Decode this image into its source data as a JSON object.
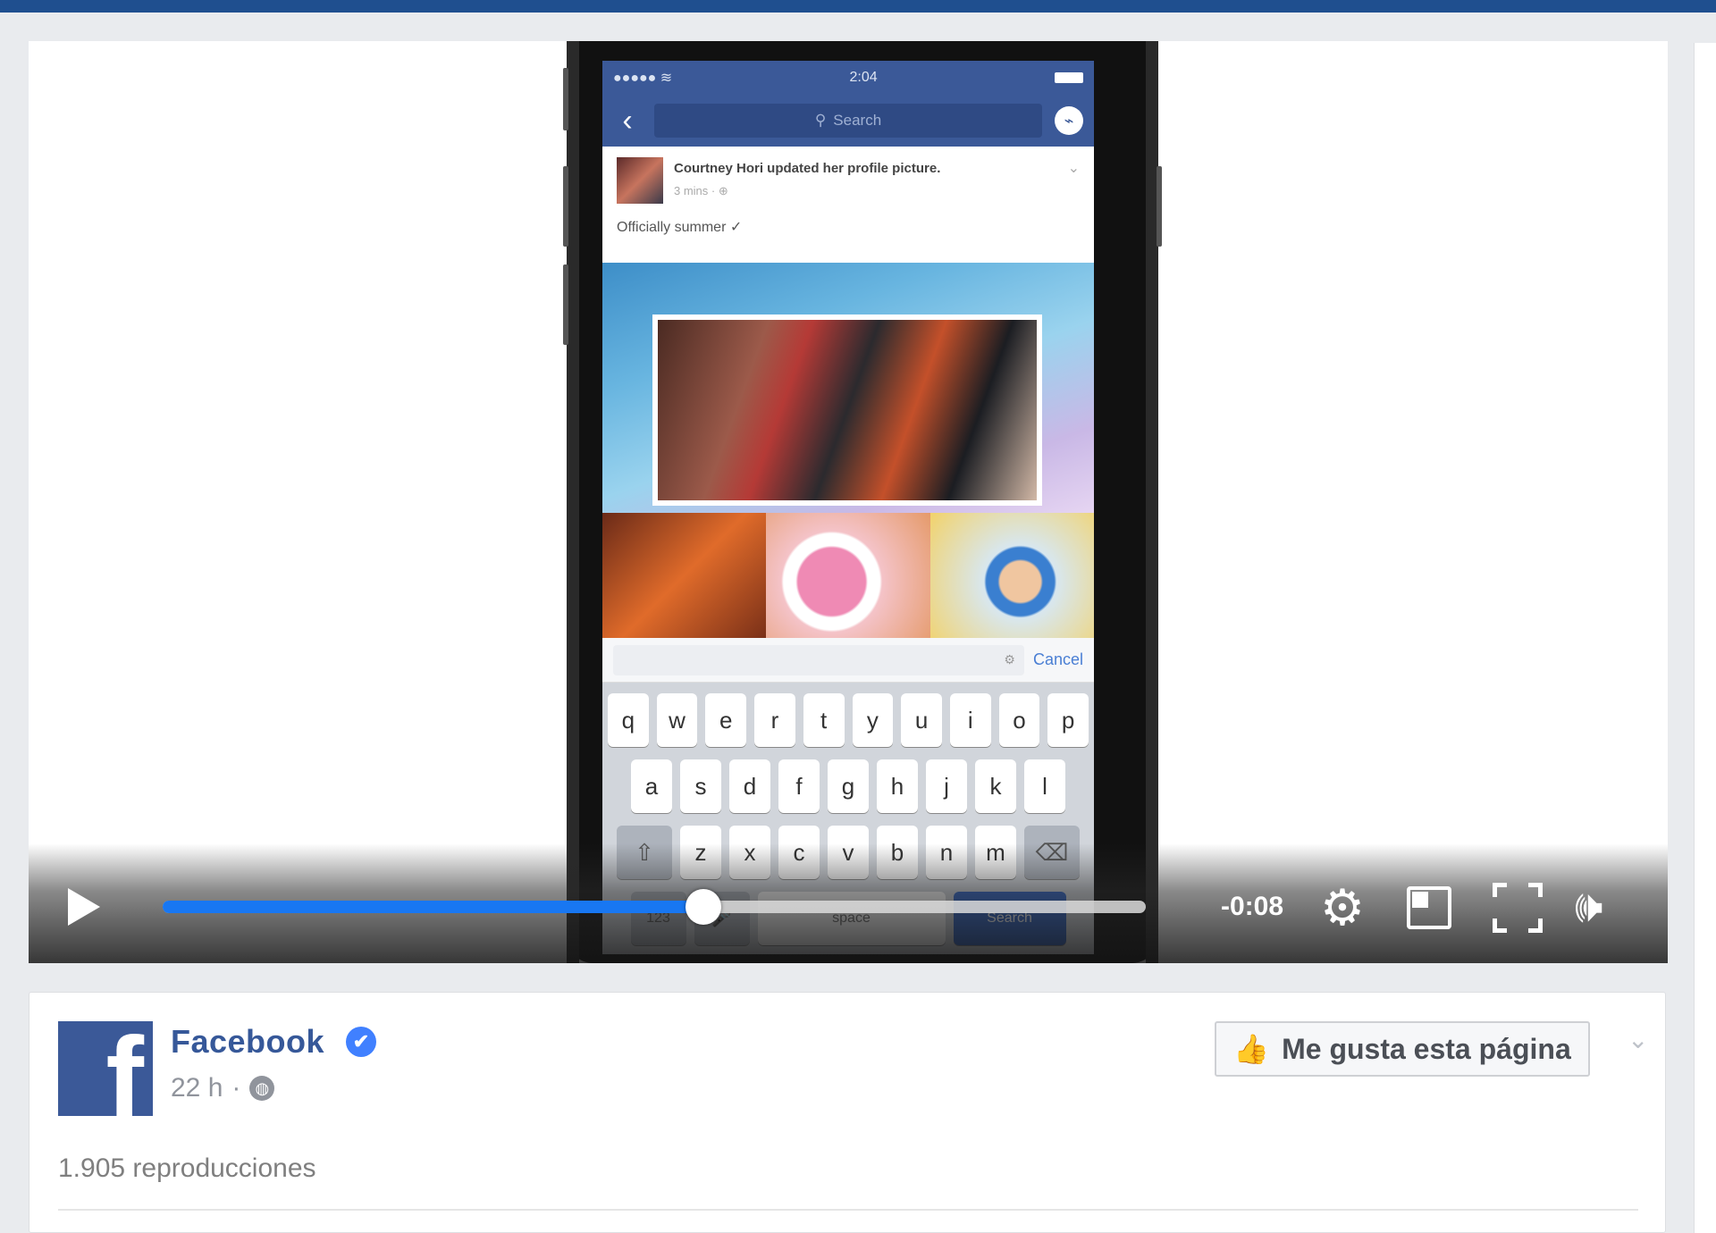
{
  "video": {
    "phone": {
      "status_time": "2:04",
      "search_placeholder": "Search",
      "post_author_text": "Courtney Hori updated her profile picture.",
      "post_meta": "3 mins · ⊕",
      "post_text": "Officially summer ✓",
      "cancel_label": "Cancel",
      "keyboard_rows": [
        [
          "q",
          "w",
          "e",
          "r",
          "t",
          "y",
          "u",
          "i",
          "o",
          "p"
        ],
        [
          "a",
          "s",
          "d",
          "f",
          "g",
          "h",
          "j",
          "k",
          "l"
        ],
        [
          "z",
          "x",
          "c",
          "v",
          "b",
          "n",
          "m"
        ]
      ],
      "space_label": "space",
      "go_label": "Search"
    },
    "controls": {
      "progress": 0.55,
      "time_remaining": "-0:08",
      "progress_color": "#1877f2"
    }
  },
  "post": {
    "page_name": "Facebook",
    "avatar_letter": "f",
    "verified_icon": "✔",
    "timestamp": "22 h",
    "separator": "·",
    "privacy_icon": "globe-icon",
    "like_button_label": "Me gusta esta página",
    "views_text": "1.905 reproducciones"
  },
  "colors": {
    "brand": "#3b5998",
    "link": "#365899",
    "verified": "#4080ff"
  }
}
